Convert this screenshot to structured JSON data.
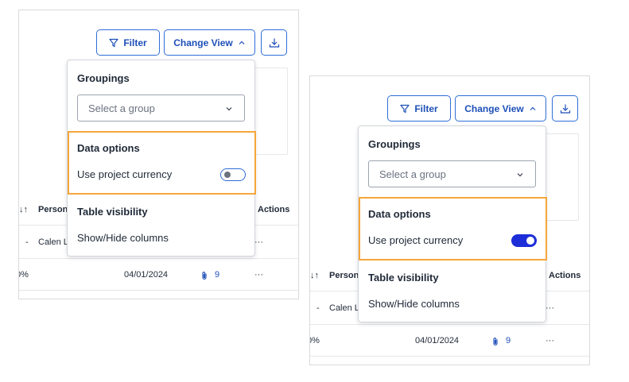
{
  "toolbar": {
    "filter_label": "Filter",
    "change_view_label": "Change View",
    "download_icon": "download-icon"
  },
  "menu": {
    "groupings_title": "Groupings",
    "group_select_placeholder": "Select a group",
    "data_options_title": "Data options",
    "project_currency_label": "Use project currency",
    "table_visibility_title": "Table visibility",
    "show_hide_columns_label": "Show/Hide columns"
  },
  "table": {
    "sort_glyph": "↓↑",
    "col_person": "Person",
    "col_actions": "Actions",
    "row1_dash": "-",
    "row1_person": "Calen L",
    "row2_percent": "0%",
    "row2_date": "04/01/2024",
    "row2_attachments": "9",
    "more_glyph": "···"
  },
  "states": [
    {
      "panel": "left",
      "project_currency_on": false
    },
    {
      "panel": "right",
      "project_currency_on": true
    }
  ],
  "colors": {
    "accent": "#2f6dd7",
    "highlight": "#f5a63a",
    "toggle_on": "#1d2ed9"
  }
}
